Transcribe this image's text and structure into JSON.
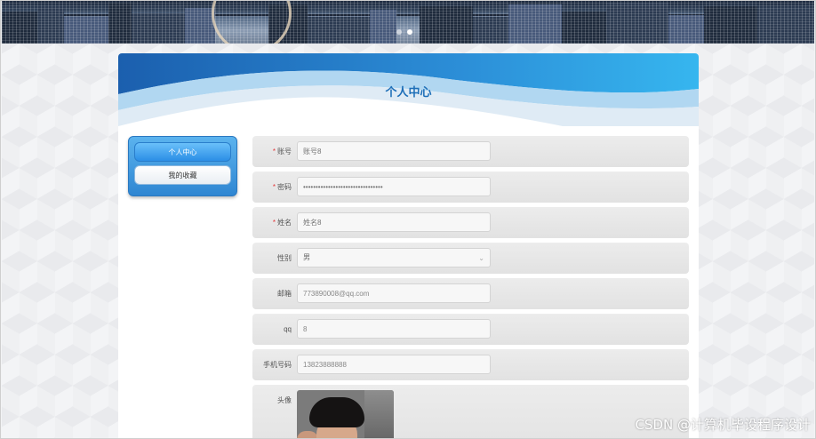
{
  "banner": {
    "slide_count": 2,
    "active_slide": 1
  },
  "card": {
    "title": "个人中心"
  },
  "sidebar": {
    "items": [
      {
        "label": "个人中心",
        "active": true
      },
      {
        "label": "我的收藏",
        "active": false
      }
    ]
  },
  "form": {
    "account": {
      "label": "账号",
      "required": "*",
      "value": "",
      "placeholder": "账号8"
    },
    "password": {
      "label": "密码",
      "required": "*",
      "value": "••••••••••••••••••••••••••••••••"
    },
    "name": {
      "label": "姓名",
      "required": "*",
      "value": "",
      "placeholder": "姓名8"
    },
    "gender": {
      "label": "性别",
      "value": "男"
    },
    "email": {
      "label": "邮箱",
      "value": "773890008@qq.com"
    },
    "qq": {
      "label": "qq",
      "value": "8"
    },
    "phone": {
      "label": "手机号码",
      "value": "13823888888"
    },
    "avatar": {
      "label": "头像"
    }
  },
  "watermark": "CSDN @计算机毕设程序设计",
  "colors": {
    "accent": "#2b8ee6",
    "title": "#1e6fb8",
    "required": "#e4393c"
  }
}
